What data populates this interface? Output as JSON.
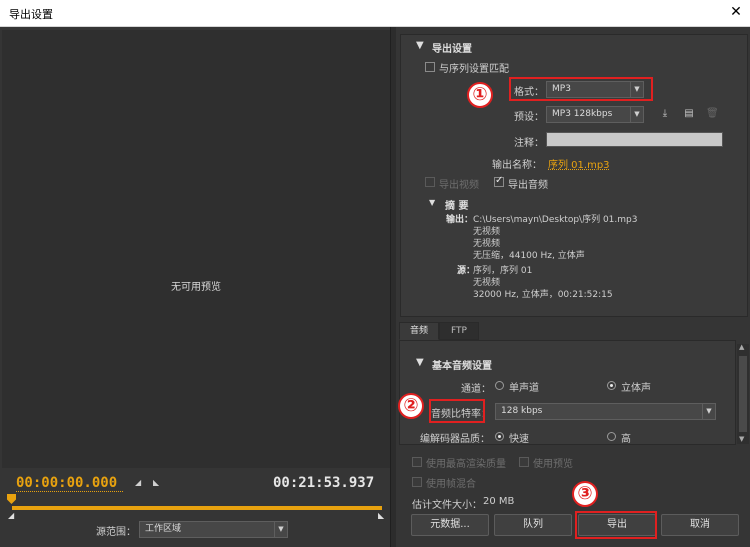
{
  "window": {
    "title": "导出设置",
    "close_glyph": "✕"
  },
  "preview": {
    "no_preview": "无可用预览",
    "timecode_in": "00:00:00.000",
    "timecode_out": "00:21:53.937",
    "source_range_label": "源范围：",
    "source_range_value": "工作区域"
  },
  "export_settings": {
    "section_title": "导出设置",
    "match_sequence_label": "与序列设置匹配",
    "format_label": "格式：",
    "format_value": "MP3",
    "preset_label": "预设：",
    "preset_value": "MP3 128kbps",
    "comments_label": "注释：",
    "comments_value": "",
    "output_name_label": "输出名称：",
    "output_name_value": "序列 01.mp3",
    "export_video_label": "导出视频",
    "export_audio_label": "导出音频",
    "summary": {
      "title": "摘 要",
      "output_label": "输出：",
      "output_lines": [
        "C:\\Users\\mayn\\Desktop\\序列 01.mp3",
        "无视频",
        "无视频",
        "无压缩，44100 Hz, 立体声"
      ],
      "source_label": "源：",
      "source_lines": [
        "序列，序列 01",
        "无视频",
        "32000 Hz, 立体声，00:21:52:15"
      ]
    }
  },
  "tabs": [
    "音频",
    "FTP"
  ],
  "audio": {
    "section_title": "基本音频设置",
    "channels_label": "通道：",
    "mono_label": "单声道",
    "stereo_label": "立体声",
    "bitrate_label": "音频比特率：",
    "bitrate_value": "128 kbps",
    "codec_quality_label": "编解码器品质：",
    "fast_label": "快速",
    "high_label": "高"
  },
  "bottom": {
    "max_render_quality_label": "使用最高渲染质量",
    "use_preview_label": "使用预览",
    "frame_blending_label": "使用帧混合",
    "file_size_label": "估计文件大小：",
    "file_size_value": "20 MB",
    "metadata_button": "元数据...",
    "queue_button": "队列",
    "export_button": "导出",
    "cancel_button": "取消"
  },
  "annotations": {
    "one": "①",
    "two": "②",
    "three": "③"
  },
  "colors": {
    "accent": "#e8a20f",
    "panel_bg": "#353535",
    "highlight_red": "#e02020"
  },
  "icons": {
    "save_preset": "download-icon",
    "import_preset": "folder-icon",
    "delete_preset": "trash-icon",
    "section_toggle": "triangle-down-icon"
  }
}
